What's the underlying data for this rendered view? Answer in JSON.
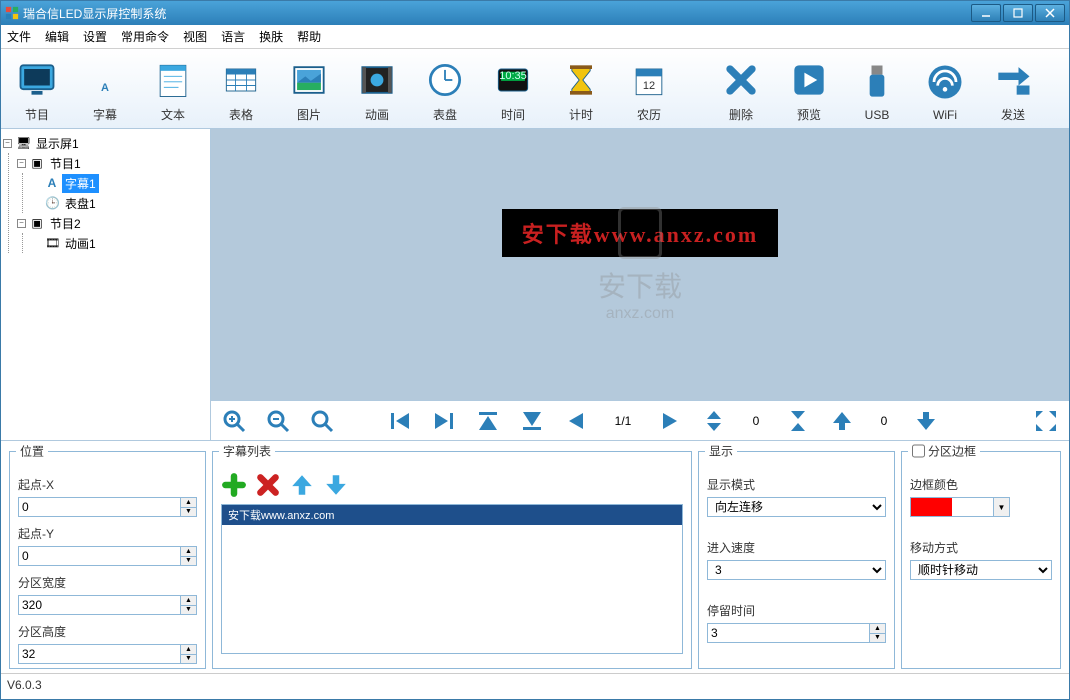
{
  "title": "瑞合信LED显示屏控制系统",
  "menu": [
    "文件",
    "编辑",
    "设置",
    "常用命令",
    "视图",
    "语言",
    "换肤",
    "帮助"
  ],
  "toolbar": [
    {
      "name": "program",
      "label": "节目"
    },
    {
      "name": "subtitle",
      "label": "字幕"
    },
    {
      "name": "text",
      "label": "文本"
    },
    {
      "name": "table",
      "label": "表格"
    },
    {
      "name": "picture",
      "label": "图片"
    },
    {
      "name": "animation",
      "label": "动画"
    },
    {
      "name": "dial",
      "label": "表盘"
    },
    {
      "name": "time",
      "label": "时间"
    },
    {
      "name": "timer",
      "label": "计时"
    },
    {
      "name": "lunar",
      "label": "农历"
    },
    {
      "name": "delete",
      "label": "删除"
    },
    {
      "name": "preview",
      "label": "预览"
    },
    {
      "name": "usb",
      "label": "USB"
    },
    {
      "name": "wifi",
      "label": "WiFi"
    },
    {
      "name": "send",
      "label": "发送"
    }
  ],
  "tree": {
    "screen": "显示屏1",
    "p1": "节目1",
    "p1_sub": "字幕1",
    "p1_dial": "表盘1",
    "p2": "节目2",
    "p2_anim": "动画1"
  },
  "led_text": "安下载www.anxz.com",
  "watermark": {
    "line1": "安下载",
    "line2": "anxz.com"
  },
  "preview_bar": {
    "page": "1/1",
    "zero": "0"
  },
  "panels": {
    "position": {
      "legend": "位置",
      "startx_lbl": "起点-X",
      "startx": "0",
      "starty_lbl": "起点-Y",
      "starty": "0",
      "width_lbl": "分区宽度",
      "width": "320",
      "height_lbl": "分区高度",
      "height": "32"
    },
    "list": {
      "legend": "字幕列表",
      "item": "安下载www.anxz.com"
    },
    "display": {
      "legend": "显示",
      "mode_lbl": "显示模式",
      "mode": "向左连移",
      "speed_lbl": "进入速度",
      "speed": "3",
      "stay_lbl": "停留时间",
      "stay": "3"
    },
    "border": {
      "legend": "分区边框",
      "color_lbl": "边框颜色",
      "move_lbl": "移动方式",
      "move": "顺时针移动"
    }
  },
  "status": "V6.0.3"
}
